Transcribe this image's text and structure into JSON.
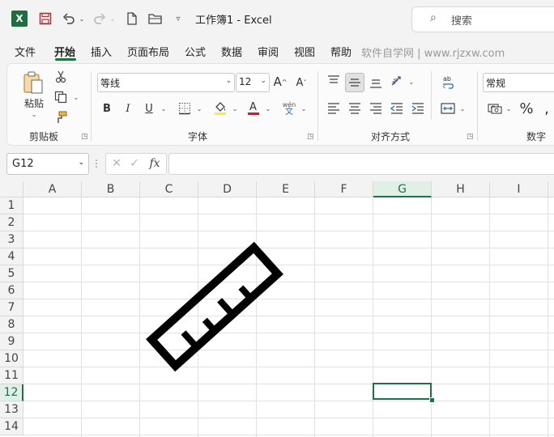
{
  "title_bar": {
    "title": "工作簿1  -  Excel",
    "search_label": "搜索",
    "logo_letter": "X"
  },
  "tabs": [
    "文件",
    "开始",
    "插入",
    "页面布局",
    "公式",
    "数据",
    "审阅",
    "视图",
    "帮助"
  ],
  "active_tab": "开始",
  "watermark": "软件自学网 | www.rjzxw.com",
  "ribbon": {
    "clipboard": {
      "paste_label": "粘贴",
      "group_label": "剪贴板"
    },
    "font": {
      "font_name": "等线",
      "font_size": "12",
      "group_label": "字体",
      "phonetic_top": "wén",
      "phonetic_bottom": "文"
    },
    "alignment": {
      "group_label": "对齐方式"
    },
    "number": {
      "format": "常规",
      "group_label": "数字"
    }
  },
  "formula_bar": {
    "name_box": "G12",
    "fx_label": "fx",
    "formula": ""
  },
  "grid": {
    "columns": [
      "A",
      "B",
      "C",
      "D",
      "E",
      "F",
      "G",
      "H",
      "I"
    ],
    "rows": [
      "1",
      "2",
      "3",
      "4",
      "5",
      "6",
      "7",
      "8",
      "9",
      "10",
      "11",
      "12",
      "13",
      "14"
    ],
    "selected_column": "G",
    "selected_row": "12"
  },
  "colors": {
    "accent": "#1e7145",
    "excel_green": "#1d6f42"
  }
}
